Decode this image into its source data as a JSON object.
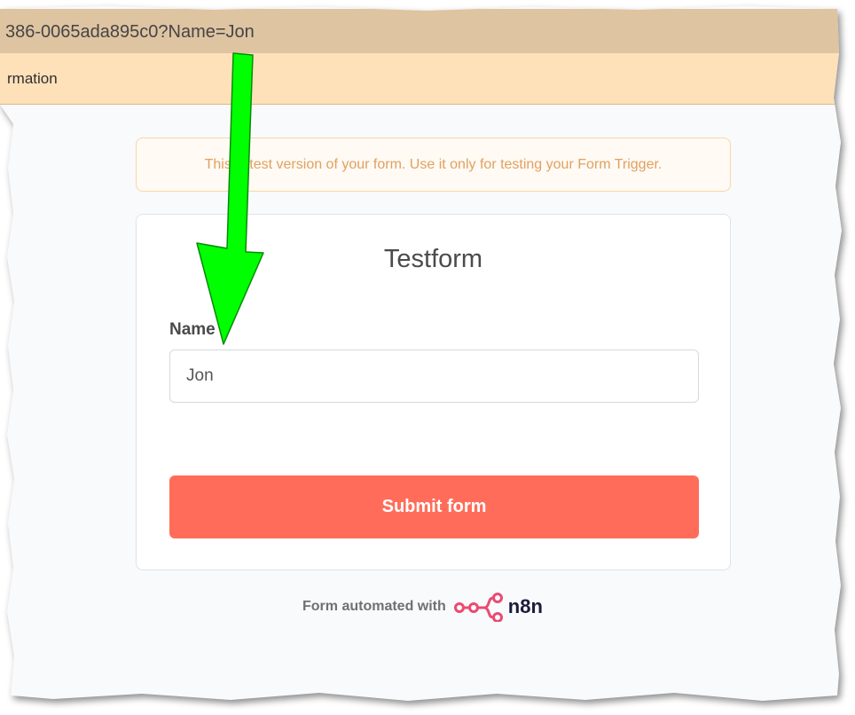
{
  "browser": {
    "url_fragment": "386-0065ada895c0?Name=Jon",
    "info_text": "rmation"
  },
  "form_page": {
    "test_notice": "This is test version of your form. Use it only for testing your Form Trigger.",
    "title": "Testform",
    "fields": [
      {
        "label": "Name",
        "value": "Jon"
      }
    ],
    "submit_label": "Submit form",
    "footer_text": "Form automated with",
    "brand_logo_text": "n8n"
  },
  "colors": {
    "url_bar": "#dfc4a2",
    "info_bar": "#fee1b8",
    "submit_button": "#ff6d5a",
    "brand_pink": "#ea4b71",
    "annotation_arrow": "#00ff00"
  },
  "annotation": {
    "icon": "arrow-down-icon",
    "color": "#00ff00"
  }
}
